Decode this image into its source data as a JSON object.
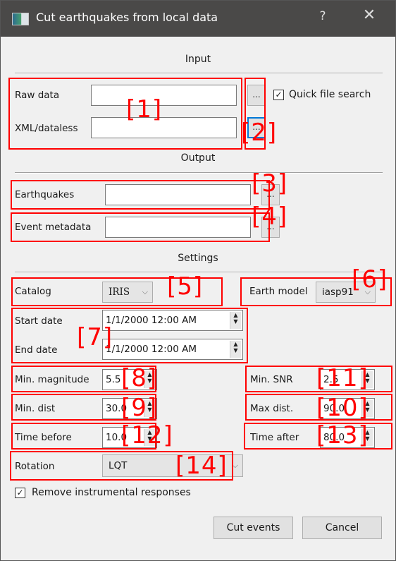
{
  "window": {
    "title": "Cut earthquakes from local data",
    "help_label": "?",
    "close_label": "✕"
  },
  "sections": {
    "input": "Input",
    "output": "Output",
    "settings": "Settings"
  },
  "input": {
    "raw_data_label": "Raw data",
    "raw_data_value": "",
    "xml_label": "XML/dataless",
    "xml_value": "",
    "browse_label": "...",
    "quick_search_label": "Quick file search",
    "quick_search_checked": true
  },
  "output": {
    "earthquakes_label": "Earthquakes",
    "earthquakes_value": "",
    "event_metadata_label": "Event metadata",
    "event_metadata_value": "",
    "browse_label": "..."
  },
  "settings": {
    "catalog_label": "Catalog",
    "catalog_value": "IRIS",
    "earth_model_label": "Earth model",
    "earth_model_value": "iasp91",
    "start_date_label": "Start date",
    "start_date_value": "1/1/2000 12:00 AM",
    "end_date_label": "End date",
    "end_date_value": "1/1/2000 12:00 AM",
    "min_magnitude_label": "Min. magnitude",
    "min_magnitude_value": "5.5",
    "min_snr_label": "Min. SNR",
    "min_snr_value": "2.5",
    "min_dist_label": "Min. dist",
    "min_dist_value": "30.0",
    "max_dist_label": "Max dist.",
    "max_dist_value": "90.0",
    "time_before_label": "Time before",
    "time_before_value": "10.0",
    "time_after_label": "Time after",
    "time_after_value": "80.0",
    "rotation_label": "Rotation",
    "rotation_value": "LQT",
    "remove_response_label": "Remove instrumental responses",
    "remove_response_checked": true
  },
  "buttons": {
    "cut_events": "Cut events",
    "cancel": "Cancel"
  },
  "annotations": {
    "colors": {
      "overlay": "#ff0000",
      "focus": "#0078d7",
      "titlebar": "#4a4948"
    },
    "tags": [
      "[1]",
      "[2]",
      "[3]",
      "[4]",
      "[5]",
      "[6]",
      "[7]",
      "[8]",
      "[9]",
      "[10]",
      "[11]",
      "[12]",
      "[13]",
      "[14]"
    ]
  },
  "icons": {
    "check": "✓",
    "chevron_down": "⌵",
    "spin_up": "▲",
    "spin_down": "▼"
  }
}
